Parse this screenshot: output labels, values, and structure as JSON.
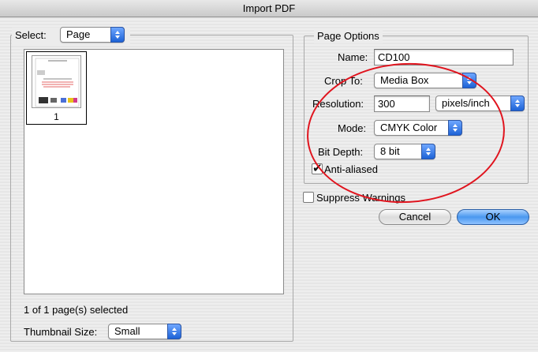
{
  "window": {
    "title": "Import PDF"
  },
  "left": {
    "select_label": "Select:",
    "select_value": "Page",
    "thumbnail_page_number": "1",
    "status": "1 of 1 page(s) selected",
    "thumbnail_size_label": "Thumbnail Size:",
    "thumbnail_size_value": "Small"
  },
  "page_options": {
    "legend": "Page Options",
    "name_label": "Name:",
    "name_value": "CD100",
    "crop_label": "Crop To:",
    "crop_value": "Media Box",
    "resolution_label": "Resolution:",
    "resolution_value": "300",
    "resolution_unit": "pixels/inch",
    "mode_label": "Mode:",
    "mode_value": "CMYK Color",
    "bit_depth_label": "Bit Depth:",
    "bit_depth_value": "8 bit",
    "anti_aliased_label": "Anti-aliased",
    "anti_aliased_checked": true
  },
  "footer": {
    "suppress_warnings_label": "Suppress Warnings",
    "suppress_warnings_checked": false,
    "cancel_label": "Cancel",
    "ok_label": "OK"
  },
  "colors": {
    "annotation_red": "#e0141e",
    "default_button_blue": "#4a98ef"
  }
}
